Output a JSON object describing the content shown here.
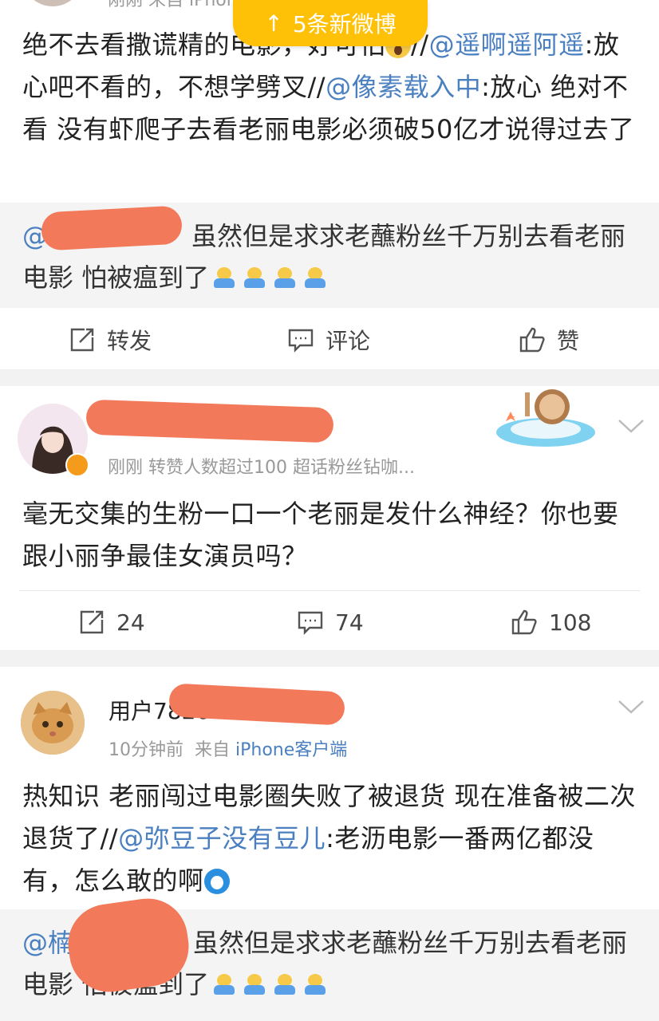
{
  "toast": {
    "arrow": "↑",
    "label": "5条新微博"
  },
  "post1": {
    "meta": "刚刚 来自 iPhone",
    "text_a": "绝不去看撒谎精的电影，好可怕",
    "text_b": "//",
    "mention_1": "@遥啊遥阿遥",
    "text_c": ":放心吧不看的，不想学劈叉//",
    "mention_2": "@像素载入中",
    "text_d": ":放心  绝对不看  没有虾爬子去看老丽电影必须破50亿才说得过去了",
    "quote_prefix": "@",
    "quote": "虽然但是求求老蘸粉丝千万别去看老丽电影 怕被瘟到了",
    "actions": {
      "repost": "转发",
      "comment": "评论",
      "like": "赞"
    }
  },
  "post2": {
    "subline": "刚刚  转赞人数超过100   超话粉丝钻咖...",
    "text": "毫无交集的生粉一口一个老丽是发什么神经？你也要跟小丽争最佳女演员吗？",
    "actions": {
      "repost": "24",
      "comment": "74",
      "like": "108"
    }
  },
  "post3": {
    "username": "用户782649366",
    "time": "10分钟前",
    "from_label": "来自",
    "source": "iPhone客户端",
    "text_a": "热知识 老丽闯过电影圈失败了被退货 现在准备被二次退货了//",
    "mention": "@弥豆子没有豆儿",
    "text_b": ":老沥电影一番两亿都没有，怎么敢的啊",
    "quote_prefix": "@楠",
    "quote": "虽然但是求求老蘸粉丝千万别去看老丽电影 怕被瘟到了"
  },
  "icons": {
    "repost": "repost-icon",
    "comment": "comment-icon",
    "like": "like-icon",
    "more": "chevron-down-icon",
    "emoji": "hugging-emoji",
    "scream": "scream-emoji",
    "doraemon": "doraemon-emoji"
  },
  "colors": {
    "link": "#4a7fc0",
    "toast": "#ffc107",
    "redaction": "#f2795a",
    "vip_badge": "#f59b1c"
  }
}
